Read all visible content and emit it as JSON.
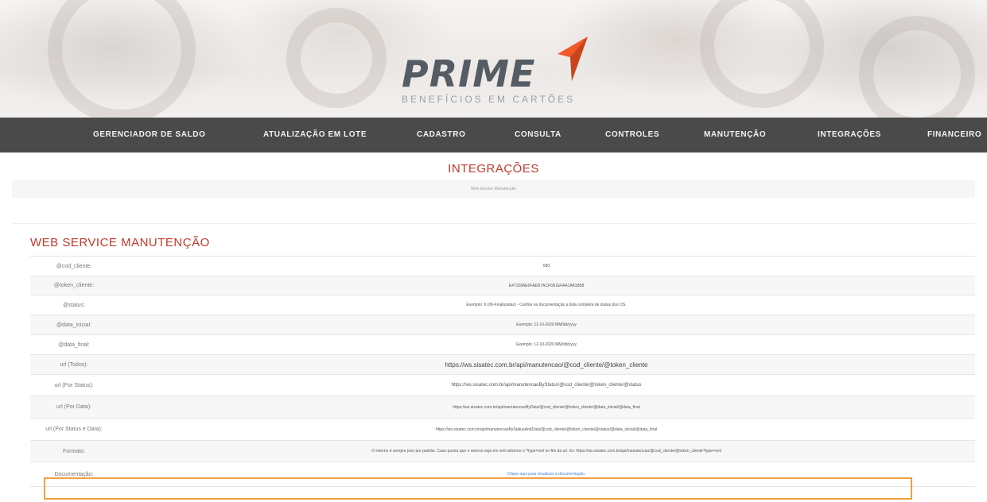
{
  "logo": {
    "wordmark": "PRIME",
    "tagline": "BENEFÍCIOS EM CARTÕES",
    "accent_color": "#f05a28",
    "wordmark_color": "#555c63"
  },
  "nav": {
    "background": "#4a4a4a",
    "items": [
      {
        "label": "GERENCIADOR DE SALDO"
      },
      {
        "label": "ATUALIZAÇÃO EM LOTE"
      },
      {
        "label": "CADASTRO"
      },
      {
        "label": "CONSULTA"
      },
      {
        "label": "CONTROLES"
      },
      {
        "label": "MANUTENÇÃO"
      },
      {
        "label": "INTEGRAÇÕES"
      },
      {
        "label": "FINANCEIRO"
      }
    ]
  },
  "page": {
    "title": "INTEGRAÇÕES",
    "title_color": "#c0392b",
    "breadcrumb": "Web Service Manutenção"
  },
  "section": {
    "title": "WEB SERVICE MANUTENÇÃO",
    "rows": [
      {
        "label": "@cod_cliente:",
        "value": "580"
      },
      {
        "label": "@token_cliente:",
        "value": "E47158AE0FAEB7ACF6B1EFAA1A81B58"
      },
      {
        "label": "@status:",
        "value": "Exemplo: 6 (06-Finalizadas) - Confira na documentação a lista completa de status dos OS."
      },
      {
        "label": "@data_inicial:",
        "value": "Exemplo: 11-10-2020 MM/dd/yyyy"
      },
      {
        "label": "@data_final:",
        "value": "Exemplo: 12-10-2020 MM/dd/yyyy"
      },
      {
        "label": "url (Todos):",
        "value": "https://ws.sisatec.com.br/api/manutencao/@cod_cliente/@token_cliente"
      },
      {
        "label": "url (Por Status):",
        "value": "https://ws.sisatec.com.br/api/manutencaoByStatus/@cod_cliente/@token_cliente/@status"
      },
      {
        "label": "url (Por Data):",
        "value": "https://ws.sisatec.com.br/api/manutencaoByData/@cod_cliente/@token_cliente/@data_inicial/@data_final"
      },
      {
        "label": "url (Por Status e Data):",
        "value": "https://ws.sisatec.com.br/api/manutencaoByStatusAndData/@cod_cliente/@token_cliente/@status/@data_inicial/@data_final"
      },
      {
        "label": "Formato:",
        "value": "O retorno é sempre json por padrão. Caso queira que o retorno seja em xml adicione o ?type=xml no fim da url. Ex: https://ws.sisatec.com.br/api/manutencao/@cod_cliente/@token_cliente?type=xml"
      },
      {
        "label": "Documentação:",
        "value": "Clique aqui para visualizar a documentação."
      }
    ]
  }
}
